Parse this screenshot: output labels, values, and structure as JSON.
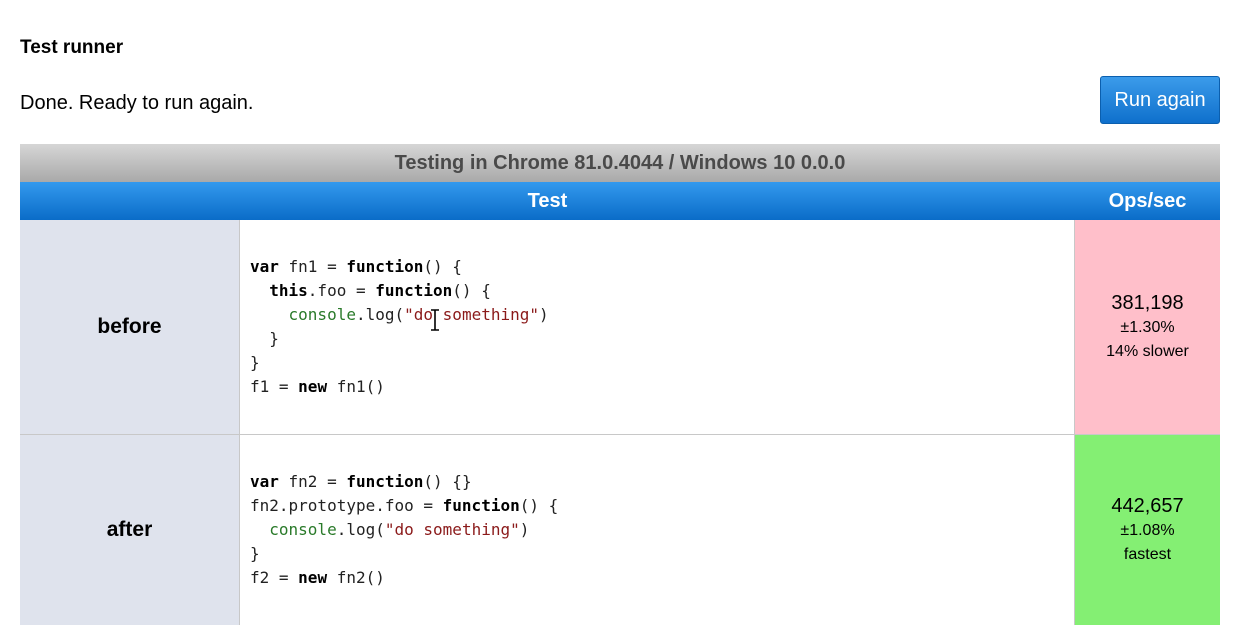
{
  "page": {
    "heading": "Test runner",
    "status": "Done. Ready to run again.",
    "run_button": "Run again"
  },
  "results": {
    "caption": "Testing in Chrome 81.0.4044 / Windows 10 0.0.0",
    "columns": {
      "test": "Test",
      "ops": "Ops/sec"
    },
    "rows": [
      {
        "name": "before",
        "code": {
          "l1_kw1": "var",
          "l1_t1": " fn1 = ",
          "l1_kw2": "function",
          "l1_t2": "() {",
          "l2_indent": "  ",
          "l2_kw1": "this",
          "l2_t1": ".foo = ",
          "l2_kw2": "function",
          "l2_t2": "() {",
          "l3_indent": "    ",
          "l3_cn": "console",
          "l3_t1": ".log(",
          "l3_str": "\"do something\"",
          "l3_t2": ")",
          "l4": "  }",
          "l5": "}",
          "l6_t1": "f1 = ",
          "l6_kw": "new",
          "l6_t2": " fn1()"
        },
        "ops": "381,198",
        "error": "±1.30%",
        "relative": "14% slower",
        "color": "#ffbfca"
      },
      {
        "name": "after",
        "code": {
          "l1_kw1": "var",
          "l1_t1": " fn2 = ",
          "l1_kw2": "function",
          "l1_t2": "() {}",
          "l2_t1": "fn2.prototype.foo = ",
          "l2_kw": "function",
          "l2_t2": "() {",
          "l3_indent": "  ",
          "l3_cn": "console",
          "l3_t1": ".log(",
          "l3_str": "\"do something\"",
          "l3_t2": ")",
          "l4": "}",
          "l5_t1": "f2 = ",
          "l5_kw": "new",
          "l5_t2": " fn2()"
        },
        "ops": "442,657",
        "error": "±1.08%",
        "relative": "fastest",
        "color": "#84ef73"
      }
    ]
  },
  "icons": {
    "text_cursor": "text-cursor-icon"
  },
  "colors": {
    "accent": "#0a6cc8",
    "caption_bg": "#a9a9a9",
    "name_cell_bg": "#dfe3ed"
  }
}
